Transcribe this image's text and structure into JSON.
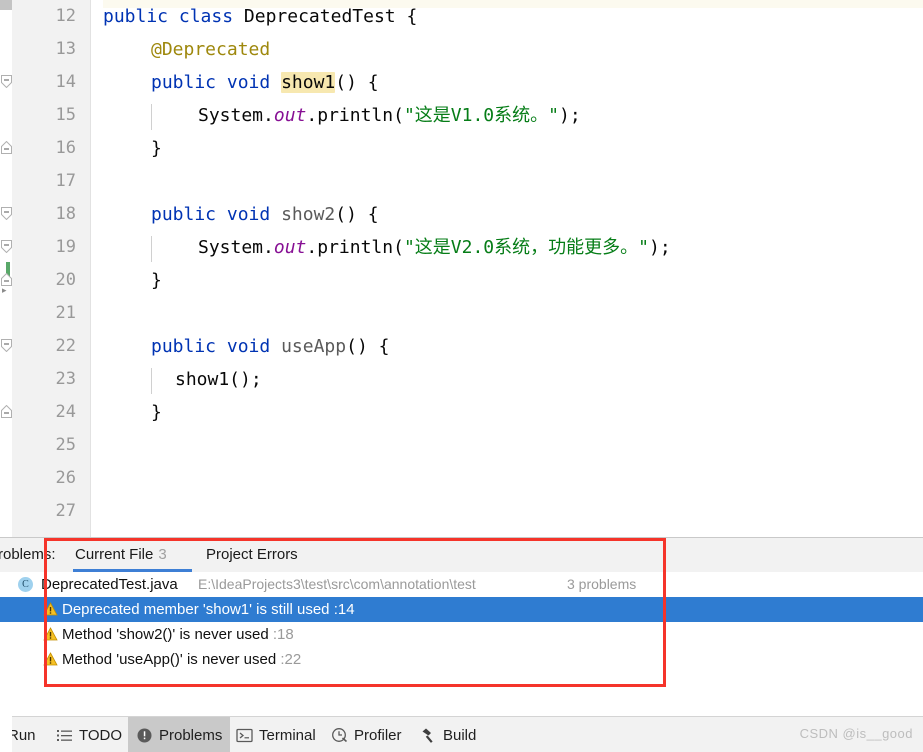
{
  "editor": {
    "first_line": 12,
    "lines": [
      {
        "num": 12,
        "indent": 0,
        "text": "public class DeprecatedTest {"
      },
      {
        "num": 13,
        "indent": 1,
        "text": "@Deprecated"
      },
      {
        "num": 14,
        "indent": 1,
        "text": "public void show1() {"
      },
      {
        "num": 15,
        "indent": 2,
        "text": "System.out.println(\"这是V1.0系统。\");"
      },
      {
        "num": 16,
        "indent": 1,
        "text": "}"
      },
      {
        "num": 17,
        "indent": 0,
        "text": ""
      },
      {
        "num": 18,
        "indent": 1,
        "text": "public void show2() {"
      },
      {
        "num": 19,
        "indent": 2,
        "text": "System.out.println(\"这是V2.0系统，功能更多。\");"
      },
      {
        "num": 20,
        "indent": 1,
        "text": "}"
      },
      {
        "num": 21,
        "indent": 0,
        "text": ""
      },
      {
        "num": 22,
        "indent": 1,
        "text": "public void useApp() {"
      },
      {
        "num": 23,
        "indent": 2,
        "text": "show1();"
      },
      {
        "num": 24,
        "indent": 1,
        "text": "}"
      },
      {
        "num": 25,
        "indent": 0,
        "text": ""
      },
      {
        "num": 26,
        "indent": 0,
        "text": ""
      },
      {
        "num": 27,
        "indent": 0,
        "text": ""
      }
    ],
    "tokens": {
      "kw_public": "public",
      "kw_class": "class",
      "kw_void": "void",
      "class_name": "DeprecatedTest",
      "annotation": "@Deprecated",
      "method1": "show1",
      "method2": "show2",
      "method3": "useApp",
      "system": "System",
      "out": "out",
      "println": "println",
      "string1": "\"这是V1.0系统。\"",
      "string2": "\"这是V2.0系统，功能更多。\"",
      "call1": "show1();",
      "brace_open": "{",
      "brace_close": "}",
      "parens": "()",
      "semicolon": ";"
    },
    "highlight_term": "show1",
    "colors": {
      "keyword": "#0033b3",
      "annotation": "#9e880d",
      "string": "#067d17",
      "static_field": "#871094",
      "text": "#080808",
      "linenum": "#999999",
      "search_highlight": "#f7e8b0",
      "vcs_change": "#59a869"
    }
  },
  "panel": {
    "label": "Problems:",
    "tabs": [
      {
        "label": "Current File",
        "count": "3",
        "active": true
      },
      {
        "label": "Project Errors",
        "count": "",
        "active": false
      }
    ],
    "file": {
      "icon": "C",
      "name": "DeprecatedTest.java",
      "path": "E:\\IdeaProjects3\\test\\src\\com\\annotation\\test",
      "count": "3 problems"
    },
    "problems": [
      {
        "severity": "warning",
        "message": "Deprecated member 'show1' is still used",
        "line": ":14",
        "selected": true
      },
      {
        "severity": "warning",
        "message": "Method 'show2()' is never used",
        "line": ":18",
        "selected": false
      },
      {
        "severity": "warning",
        "message": "Method 'useApp()' is never used",
        "line": ":22",
        "selected": false
      }
    ],
    "selection_color": "#2f7cd1",
    "annotation_box_color": "#f5342a"
  },
  "toolbar": {
    "items": [
      {
        "label": "Run",
        "icon": "",
        "active": false
      },
      {
        "label": "TODO",
        "icon": "list-icon",
        "active": false
      },
      {
        "label": "Problems",
        "icon": "problems-icon",
        "active": true
      },
      {
        "label": "Terminal",
        "icon": "terminal-icon",
        "active": false
      },
      {
        "label": "Profiler",
        "icon": "profiler-icon",
        "active": false
      },
      {
        "label": "Build",
        "icon": "hammer-icon",
        "active": false
      }
    ]
  },
  "watermark": {
    "text": "CSDN @is__good"
  }
}
